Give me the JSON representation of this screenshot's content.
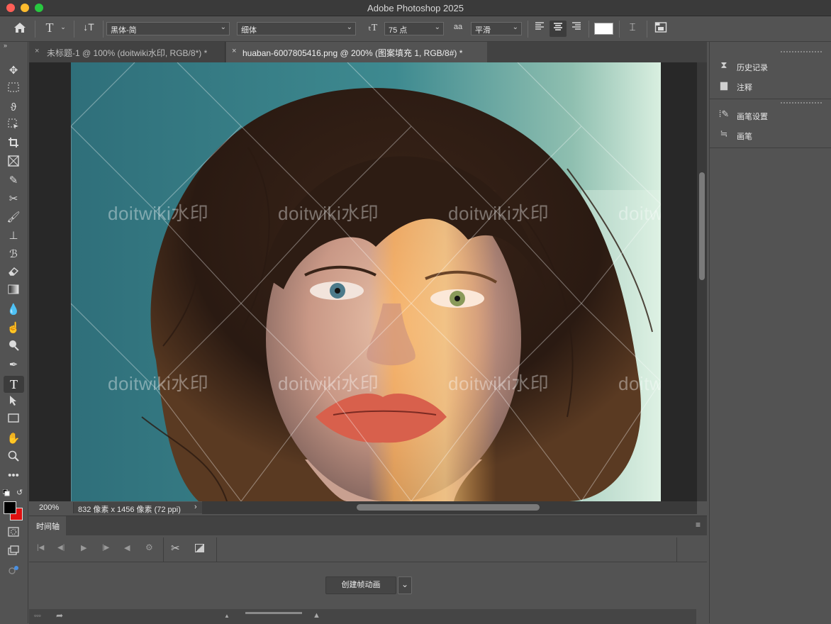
{
  "app": {
    "title": "Adobe Photoshop 2025"
  },
  "options_bar": {
    "font_family": "黑体-简",
    "font_style": "细体",
    "font_size": "75 点",
    "aa_label": "a",
    "antialias": "平滑",
    "text_color": "#ffffff"
  },
  "tabs": [
    {
      "label": "未标题-1 @ 100% (doitwiki水印, RGB/8*) *"
    },
    {
      "label": "huaban-6007805416.png @ 200% (图案填充 1, RGB/8#) *"
    }
  ],
  "canvas": {
    "watermark_text": "doitwiki水印"
  },
  "status": {
    "zoom": "200%",
    "doc_info": "832 像素 x 1456 像素 (72 ppi)"
  },
  "timeline": {
    "tab_label": "时间轴",
    "create_button": "创建帧动画"
  },
  "right_panel": {
    "items": [
      {
        "label": "历史记录"
      },
      {
        "label": "注释"
      },
      {
        "label": "画笔设置"
      },
      {
        "label": "画笔"
      }
    ]
  },
  "colors": {
    "foreground": "#000000",
    "background": "#e01010"
  }
}
